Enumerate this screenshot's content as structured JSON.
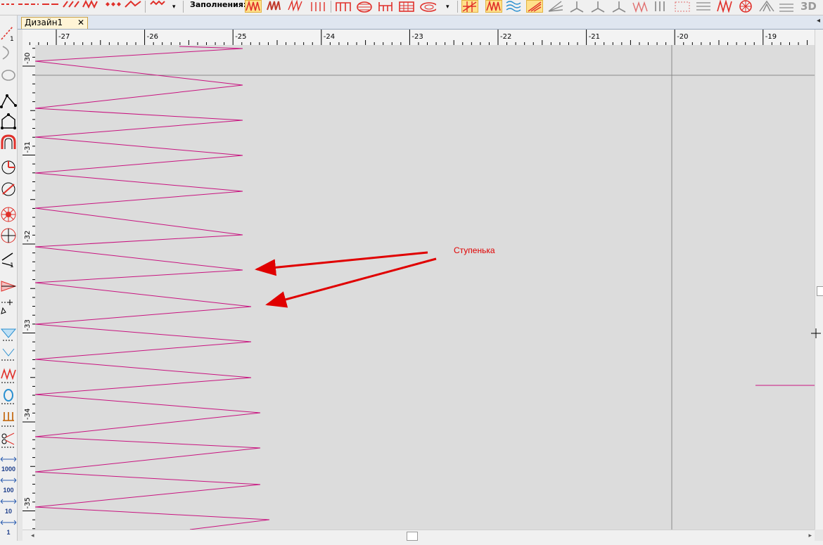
{
  "toolbar": {
    "fills_label": "Заполнения:",
    "dropdown_glyph": "▾",
    "stitch_color": "#e0302a"
  },
  "tabs": [
    {
      "label": "Дизайн1",
      "close": "✕"
    }
  ],
  "tabstrip_arrow": "◂",
  "left_toolbar": {
    "numeric_buttons": [
      "1000",
      "100",
      "10",
      "1"
    ]
  },
  "ruler": {
    "horizontal_ticks": [
      "-27",
      "-26",
      "-25",
      "-24",
      "-23",
      "-22",
      "-21",
      "-20",
      "-19"
    ],
    "vertical_ticks": [
      "-30",
      "-31",
      "-32",
      "-33",
      "-34",
      "-35"
    ]
  },
  "canvas": {
    "background": "#dcdcdc",
    "stitch_color": "#c8137f",
    "guide_color": "#8a8a8a",
    "annotation_color": "#e00000",
    "annotation_text": "Ступенька"
  },
  "scrollbars": {
    "left_arrow": "◂",
    "right_arrow": "▸"
  }
}
